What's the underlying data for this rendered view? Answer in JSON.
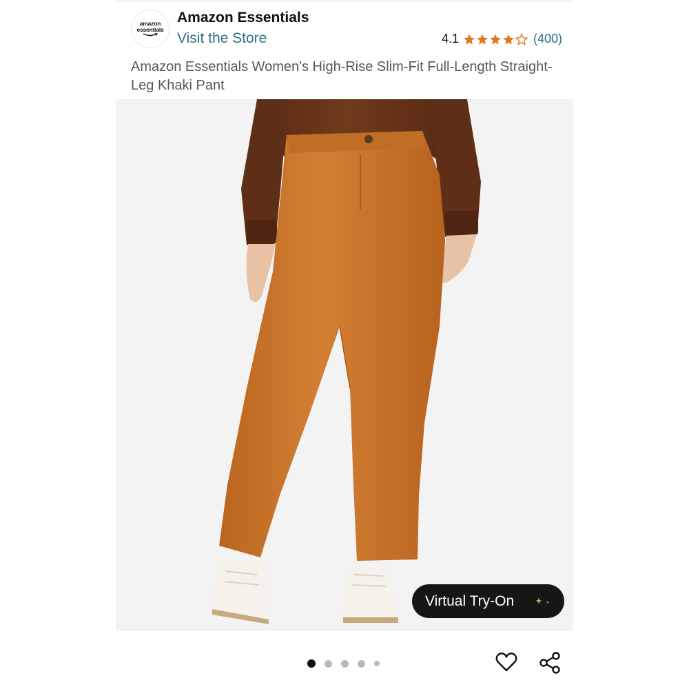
{
  "header": {
    "logo_line1": "amazon",
    "logo_line2": "essentials",
    "brand_name": "Amazon Essentials",
    "visit_store_label": "Visit the Store",
    "rating_value": "4.1",
    "rating_stars": 4.1,
    "rating_max": 5,
    "review_count": "(400)"
  },
  "product": {
    "title": "Amazon Essentials Women's High-Rise Slim-Fit Full-Length Straight-Leg Khaki Pant"
  },
  "gallery": {
    "virtual_try_on_label": "Virtual Try-On",
    "image_count": 5,
    "active_index": 0
  },
  "actions": {
    "wishlist_icon": "heart-icon",
    "share_icon": "share-icon"
  },
  "colors": {
    "link": "#2f6f86",
    "star": "#de7921",
    "pant": "#c8742b",
    "sweater": "#6b3519"
  }
}
